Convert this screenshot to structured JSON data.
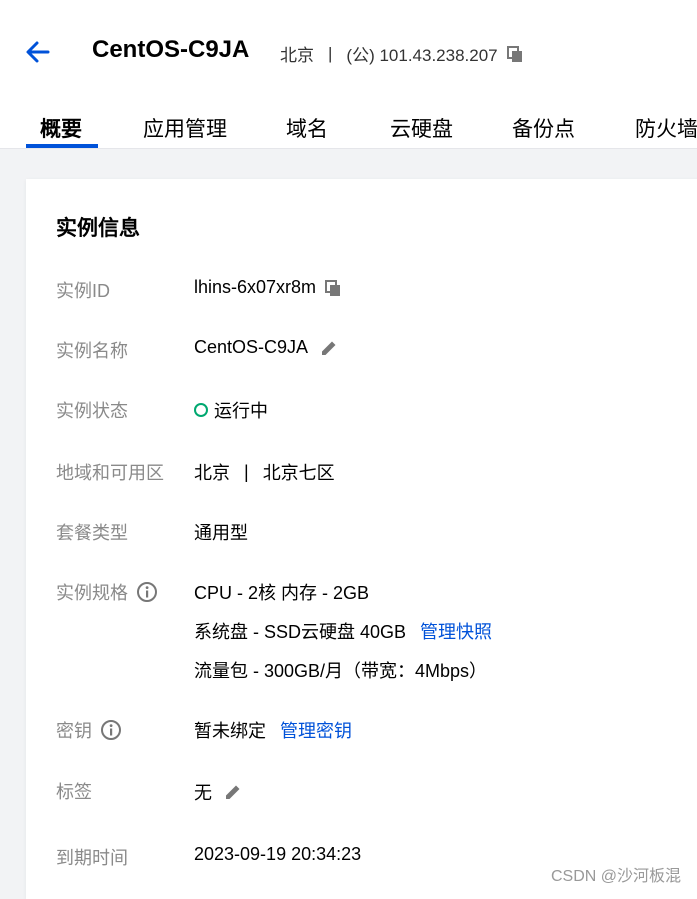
{
  "header": {
    "title": "CentOS-C9JA",
    "region": "北京",
    "separator": "|",
    "ip": "(公) 101.43.238.207"
  },
  "tabs": [
    {
      "label": "概要",
      "active": true
    },
    {
      "label": "应用管理",
      "active": false
    },
    {
      "label": "域名",
      "active": false
    },
    {
      "label": "云硬盘",
      "active": false
    },
    {
      "label": "备份点",
      "active": false
    },
    {
      "label": "防火墙",
      "active": false
    }
  ],
  "card": {
    "title": "实例信息",
    "rows": {
      "instance_id": {
        "label": "实例ID",
        "value": "lhins-6x07xr8m"
      },
      "instance_name": {
        "label": "实例名称",
        "value": "CentOS-C9JA"
      },
      "instance_status": {
        "label": "实例状态",
        "value": "运行中",
        "status_color": "#00a870"
      },
      "zone": {
        "label": "地域和可用区",
        "region": "北京",
        "separator": "|",
        "zone": "北京七区"
      },
      "plan_type": {
        "label": "套餐类型",
        "value": "通用型"
      },
      "spec": {
        "label": "实例规格",
        "cpu_mem": "CPU - 2核 内存 - 2GB",
        "disk": "系统盘 - SSD云硬盘 40GB",
        "disk_link": "管理快照",
        "traffic": "流量包 - 300GB/月（带宽：4Mbps）"
      },
      "key": {
        "label": "密钥",
        "value": "暂未绑定",
        "link": "管理密钥"
      },
      "tags": {
        "label": "标签",
        "value": "无"
      },
      "expire": {
        "label": "到期时间",
        "value": "2023-09-19 20:34:23"
      }
    }
  },
  "watermark": "CSDN @沙河板混",
  "colors": {
    "accent": "#0052d9",
    "status_running": "#00a870"
  }
}
